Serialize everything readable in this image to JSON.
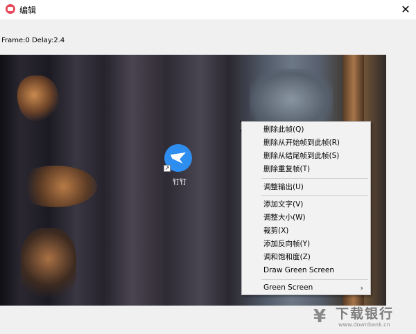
{
  "window": {
    "title": "编辑",
    "close_glyph": "✕",
    "app_icon": "app-logo-icon"
  },
  "status": {
    "text": "Frame:0  Delay:2.4"
  },
  "desktop_icon": {
    "label": "钉钉",
    "icon": "dingtalk-icon",
    "shortcut_glyph": "↗"
  },
  "context_menu": {
    "items": [
      {
        "label": "删除此帧(Q)"
      },
      {
        "label": "删除从开始帧到此帧(R)"
      },
      {
        "label": "删除从结尾帧到此帧(S)"
      },
      {
        "label": "删除重复帧(T)"
      },
      {
        "label": "调整输出(U)"
      },
      {
        "label": "添加文字(V)"
      },
      {
        "label": "调整大小(W)"
      },
      {
        "label": "裁剪(X)"
      },
      {
        "label": "添加反向帧(Y)"
      },
      {
        "label": "调和饱和度(Z)"
      },
      {
        "label": "Draw Green Screen"
      },
      {
        "label": "Green Screen",
        "submenu_glyph": "›"
      }
    ]
  },
  "watermark": {
    "text": "下载银行",
    "domain": "www.downbank.cn",
    "logo_glyph": "¥"
  }
}
